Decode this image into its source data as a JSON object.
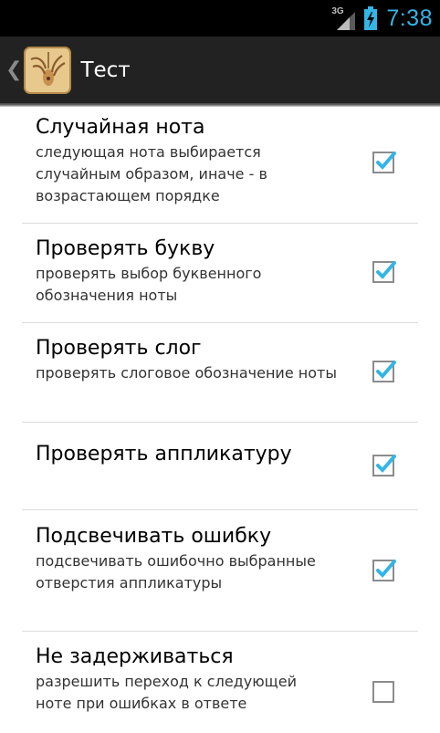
{
  "status_bar": {
    "network": "3G",
    "time": "7:38"
  },
  "action_bar": {
    "title": "Тест",
    "up_icon": "chevron-left-icon",
    "app_icon": "fingers-on-instrument-icon"
  },
  "colors": {
    "status_clock": "#33b5e5",
    "action_bar_bg": "#222222",
    "check_blue": "#33b5e5"
  },
  "preferences": [
    {
      "title": "Случайная нота",
      "summary": "следующая нота выбирается случайным образом, иначе - в возрастающем порядке",
      "checked": true
    },
    {
      "title": "Проверять букву",
      "summary": "проверять выбор буквенного обозначения ноты",
      "checked": true
    },
    {
      "title": "Проверять слог",
      "summary": "проверять слоговое обозначение ноты",
      "checked": true
    },
    {
      "title": "Проверять аппликатуру",
      "summary": "",
      "checked": true
    },
    {
      "title": "Подсвечивать ошибку",
      "summary": "подсвечивать ошибочно выбранные отверстия аппликатуры",
      "checked": true
    },
    {
      "title": "Не задерживаться",
      "summary": "разрешить переход к следующей ноте при ошибках в ответе",
      "checked": false
    }
  ]
}
